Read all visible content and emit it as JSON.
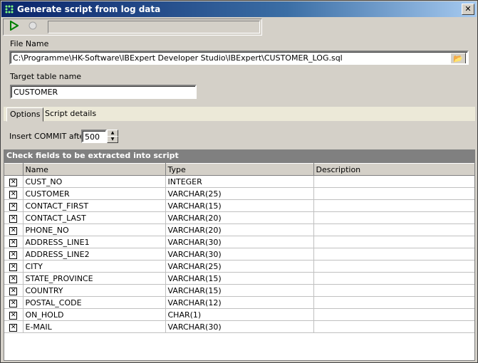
{
  "window": {
    "title": "Generate script from log data"
  },
  "file": {
    "label": "File Name",
    "value": "C:\\Programme\\HK-Software\\IBExpert Developer Studio\\IBExpert\\CUSTOMER_LOG.sql"
  },
  "target": {
    "label": "Target table name",
    "value": "CUSTOMER"
  },
  "tabs": [
    {
      "label": "Options"
    },
    {
      "label": "Script details"
    }
  ],
  "options": {
    "commit_label": "Insert COMMIT after",
    "commit_value": "500"
  },
  "grid": {
    "header": "Check fields to be extracted into script",
    "columns": [
      "",
      "Name",
      "Type",
      "Description"
    ],
    "rows": [
      {
        "checked": true,
        "name": "CUST_NO",
        "type": "INTEGER",
        "description": ""
      },
      {
        "checked": true,
        "name": "CUSTOMER",
        "type": "VARCHAR(25)",
        "description": ""
      },
      {
        "checked": true,
        "name": "CONTACT_FIRST",
        "type": "VARCHAR(15)",
        "description": ""
      },
      {
        "checked": true,
        "name": "CONTACT_LAST",
        "type": "VARCHAR(20)",
        "description": ""
      },
      {
        "checked": true,
        "name": "PHONE_NO",
        "type": "VARCHAR(20)",
        "description": ""
      },
      {
        "checked": true,
        "name": "ADDRESS_LINE1",
        "type": "VARCHAR(30)",
        "description": ""
      },
      {
        "checked": true,
        "name": "ADDRESS_LINE2",
        "type": "VARCHAR(30)",
        "description": ""
      },
      {
        "checked": true,
        "name": "CITY",
        "type": "VARCHAR(25)",
        "description": ""
      },
      {
        "checked": true,
        "name": "STATE_PROVINCE",
        "type": "VARCHAR(15)",
        "description": ""
      },
      {
        "checked": true,
        "name": "COUNTRY",
        "type": "VARCHAR(15)",
        "description": ""
      },
      {
        "checked": true,
        "name": "POSTAL_CODE",
        "type": "VARCHAR(12)",
        "description": ""
      },
      {
        "checked": true,
        "name": "ON_HOLD",
        "type": "CHAR(1)",
        "description": ""
      },
      {
        "checked": true,
        "name": "E-MAIL",
        "type": "VARCHAR(30)",
        "description": ""
      }
    ]
  }
}
